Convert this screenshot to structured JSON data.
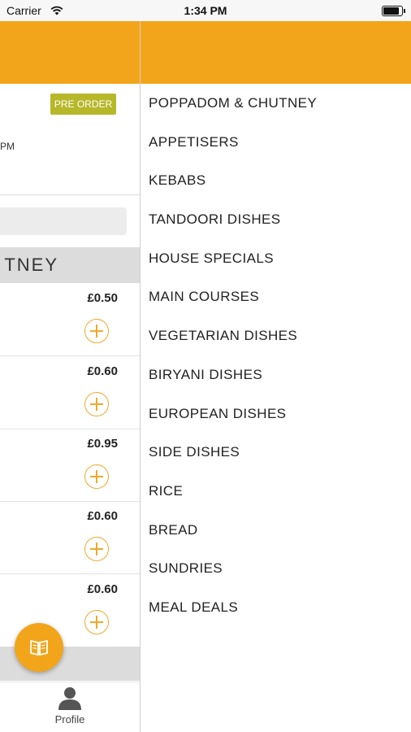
{
  "status_bar": {
    "carrier": "Carrier",
    "time": "1:34 PM"
  },
  "left_screen": {
    "preorder_label": "PRE ORDER",
    "hours_fragment": "PM",
    "category_fragment": "TNEY",
    "items": [
      {
        "price": "£0.50"
      },
      {
        "price": "£0.60"
      },
      {
        "price": "£0.95"
      },
      {
        "price": "£0.60"
      },
      {
        "price": "£0.60"
      }
    ],
    "tab_profile_label": "Profile"
  },
  "menu": {
    "categories": [
      "POPPADOM & CHUTNEY",
      "APPETISERS",
      "KEBABS",
      "TANDOORI DISHES",
      "HOUSE SPECIALS",
      "MAIN COURSES",
      "VEGETARIAN DISHES",
      "BIRYANI DISHES",
      "EUROPEAN DISHES",
      "SIDE DISHES",
      "RICE",
      "BREAD",
      "SUNDRIES",
      "MEAL DEALS"
    ]
  },
  "colors": {
    "accent": "#f2a51a",
    "preorder": "#b7b72a"
  },
  "icons": [
    "wifi-icon",
    "battery-icon",
    "add-icon",
    "menu-book-icon",
    "profile-icon"
  ]
}
